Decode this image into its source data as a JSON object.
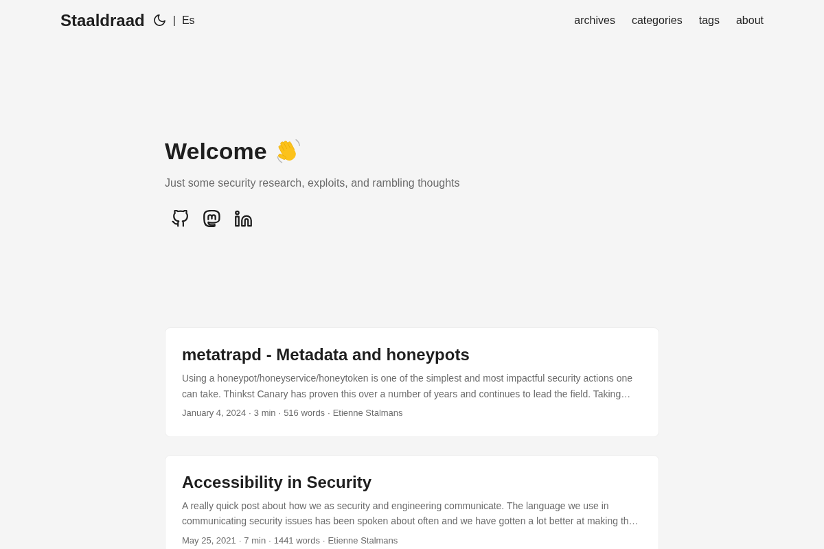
{
  "header": {
    "logo": "Staaldraad",
    "separator": "|",
    "language": "Es",
    "nav": [
      "archives",
      "categories",
      "tags",
      "about"
    ]
  },
  "intro": {
    "title": "Welcome",
    "subtitle": "Just some security research, exploits, and rambling thoughts"
  },
  "posts": [
    {
      "title": "metatrapd - Metadata and honeypots",
      "summary": "Using a honeypot/honeyservice/honeytoken is one of the simplest and most impactful security actions one can take. Thinkst Canary has proven this over a number of years and continues to lead the field. Taking…",
      "meta": "January 4, 2024 · 3 min · 516 words · Etienne Stalmans"
    },
    {
      "title": "Accessibility in Security",
      "summary": "A really quick post about how we as security and engineering communicate. The language we use in communicating security issues has been spoken about often and we have gotten a lot better at making th…",
      "meta": "May 25, 2021 · 7 min · 1441 words · Etienne Stalmans"
    }
  ]
}
